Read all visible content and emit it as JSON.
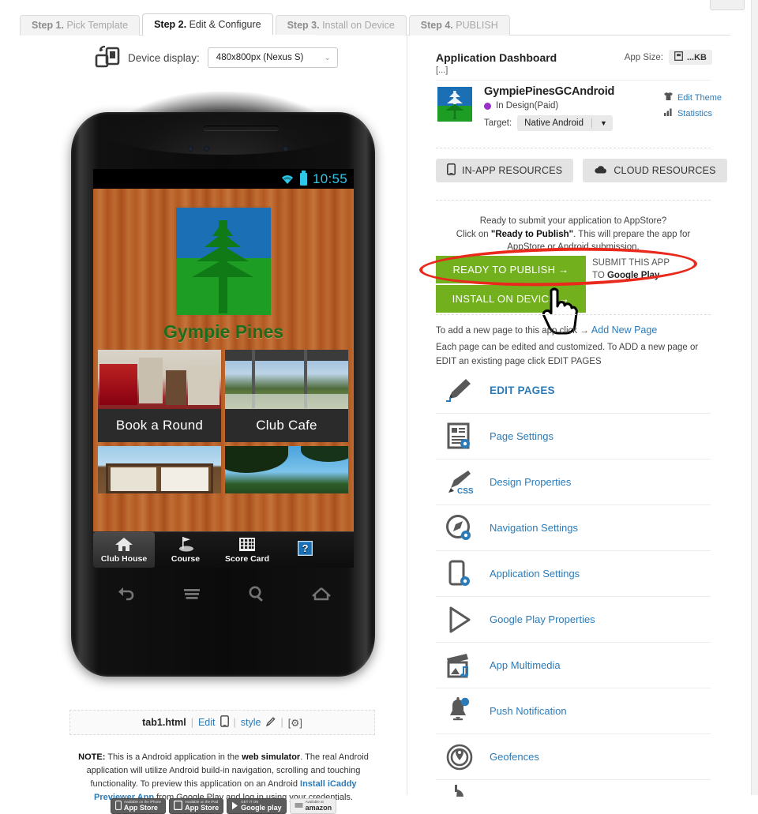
{
  "wizard": {
    "tabs": [
      {
        "step": "Step 1.",
        "label": "Pick Template",
        "active": false
      },
      {
        "step": "Step 2.",
        "label": "Edit & Configure",
        "active": true
      },
      {
        "step": "Step 3.",
        "label": "Install on Device",
        "active": false
      },
      {
        "step": "Step 4.",
        "label": "PUBLISH",
        "active": false
      }
    ]
  },
  "simulator": {
    "device_icon_name": "device-rotate-icon",
    "device_display_label": "Device display:",
    "device_display_value": "480x800px (Nexus S)",
    "phone": {
      "status_time": "10:55",
      "app_title": "Gympie Pines",
      "tiles": [
        {
          "caption": "Book a Round",
          "photo": "pro-shop-interior"
        },
        {
          "caption": "Club Cafe",
          "photo": "clubhouse-deck-view"
        },
        {
          "caption": "",
          "photo": "notice-board"
        },
        {
          "caption": "",
          "photo": "course-trees-sky"
        }
      ],
      "tabs": [
        {
          "label": "Club House",
          "icon": "home-icon",
          "selected": true
        },
        {
          "label": "Course",
          "icon": "golf-flag-icon",
          "selected": false
        },
        {
          "label": "Score Card",
          "icon": "grid-calendar-icon",
          "selected": false
        },
        {
          "label": "",
          "icon": "help-question-icon",
          "selected": false
        }
      ],
      "softkeys": [
        "back-icon",
        "menu-icon",
        "search-icon",
        "home-icon"
      ]
    },
    "file_row": {
      "filename": "tab1.html",
      "edit_label": "Edit",
      "edit_icon": "phone-icon",
      "style_label": "style",
      "style_icon": "pencil-icon",
      "gear_label": "[⚙]"
    },
    "note": {
      "prefix": "NOTE:",
      "text1": " This is a Android application in the ",
      "bold1": "web simulator",
      "text2": ". The real Android application will utilize Android build-in navigation, scrolling and touching functionality. To preview this application on an Android ",
      "link": "Install iCaddy Previewer App",
      "text3": " from Google Play and log in using your credentials."
    },
    "store_badges": [
      {
        "small": "Available on the iPhone",
        "big": "App Store",
        "icon": "iphone-icon",
        "style": "dark"
      },
      {
        "small": "Available on the iPad",
        "big": "App Store",
        "icon": "ipad-icon",
        "style": "dark"
      },
      {
        "small": "GET IT ON",
        "big": "Google play",
        "icon": "google-play-icon",
        "style": "dark"
      },
      {
        "small": "Available at",
        "big": "amazon",
        "icon": "amazon-icon",
        "style": "light"
      }
    ]
  },
  "dashboard": {
    "title": "Application Dashboard",
    "ellipsis": "[...]",
    "app_size_label": "App Size:",
    "app_size_icon": "file-icon",
    "app_size_value": "...KB",
    "app": {
      "icon_name": "gympie-pines-logo",
      "name": "GympiePinesGCAndroid",
      "status": "In Design(Paid)",
      "status_color": "#9b30c9",
      "target_label": "Target:",
      "target_value": "Native Android"
    },
    "actions": [
      {
        "label": "Edit Theme",
        "icon": "tshirt-icon"
      },
      {
        "label": "Statistics",
        "icon": "bar-chart-icon"
      }
    ],
    "resource_buttons": [
      {
        "label": "IN-APP RESOURCES",
        "icon": "phone-icon"
      },
      {
        "label": "CLOUD RESOURCES",
        "icon": "cloud-icon"
      }
    ],
    "ready_text": {
      "line1": "Ready to submit your application to AppStore?",
      "line2_pre": "Click on ",
      "line2_bold": "\"Ready to Publish\"",
      "line2_post": ". This will prepare the app for",
      "line3": "AppStore or Android submission."
    },
    "publish_buttons": [
      {
        "label": "READY TO PUBLISH →",
        "color": "#72b01d",
        "highlighted": true
      },
      {
        "label": "INSTALL ON DEVICE →",
        "color": "#72b01d",
        "highlighted": false
      }
    ],
    "submit_hint": {
      "line1": "SUBMIT THIS APP",
      "line2_pre": "TO ",
      "line2_bold": "Google Play"
    },
    "add_page": {
      "pre": "To add a new page to this app click → ",
      "link": "Add New Page",
      "desc": "Each page can be edited and customized. To ADD a new page or EDIT an existing page click EDIT PAGES"
    },
    "menu_items": [
      {
        "label": "EDIT PAGES",
        "icon": "pencil-icon",
        "strong": true
      },
      {
        "label": "Page Settings",
        "icon": "page-settings-icon",
        "strong": false
      },
      {
        "label": "Design Properties",
        "icon": "css-brush-icon",
        "strong": false
      },
      {
        "label": "Navigation Settings",
        "icon": "compass-settings-icon",
        "strong": false
      },
      {
        "label": "Application Settings",
        "icon": "phone-settings-icon",
        "strong": false
      },
      {
        "label": "Google Play Properties",
        "icon": "google-play-icon",
        "strong": false
      },
      {
        "label": "App Multimedia",
        "icon": "multimedia-icon",
        "strong": false
      },
      {
        "label": "Push Notification",
        "icon": "bell-icon",
        "strong": false
      },
      {
        "label": "Geofences",
        "icon": "geofence-pin-icon",
        "strong": false
      }
    ]
  },
  "colors": {
    "accent_link": "#2b7bb9",
    "green_button": "#72b01d",
    "highlight_oval": "#e8291c",
    "status_purple": "#9b30c9"
  }
}
